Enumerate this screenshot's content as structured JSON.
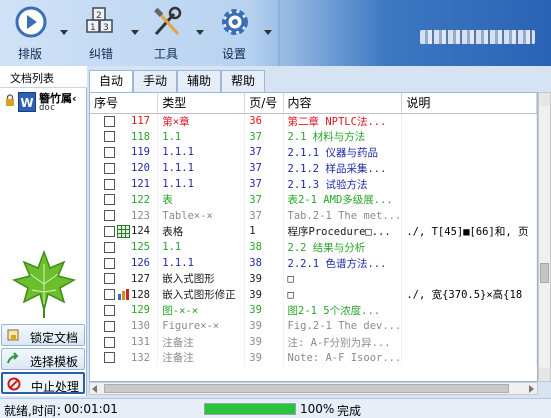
{
  "toolbar": {
    "buttons": [
      {
        "label": "排版",
        "icon": "play-icon"
      },
      {
        "label": "纠错",
        "icon": "abc-blocks-icon"
      },
      {
        "label": "工具",
        "icon": "tools-icon"
      },
      {
        "label": "设置",
        "icon": "gear-icon"
      }
    ]
  },
  "sidebar": {
    "title": "文档列表",
    "doc": {
      "name": "簪竹属‹",
      "ext": "doc",
      "icon": "word-doc-icon"
    },
    "buttons": [
      {
        "label": "锁定文档",
        "icon": "lock-doc-icon"
      },
      {
        "label": "选择模板",
        "icon": "arrow-icon"
      },
      {
        "label": "中止处理",
        "icon": "stop-icon"
      }
    ]
  },
  "tabs": [
    "自动",
    "手动",
    "辅助",
    "帮助"
  ],
  "table": {
    "columns": [
      "序号",
      "类型",
      "页/号",
      "内容",
      "说明"
    ],
    "rows": [
      {
        "num": "117",
        "type": "第×章",
        "page": "36",
        "content": "第二章  NPTLC法...",
        "desc": "",
        "color": "#e0141e"
      },
      {
        "num": "118",
        "type": "1.1",
        "page": "37",
        "content": "2.1 材料与方法",
        "desc": "",
        "color": "#2aa52a"
      },
      {
        "num": "119",
        "type": "1.1.1",
        "page": "37",
        "content": "2.1.1 仪器与药品",
        "desc": "",
        "color": "#1c2aa8"
      },
      {
        "num": "120",
        "type": "1.1.1",
        "page": "37",
        "content": "2.1.2 样品采集...",
        "desc": "",
        "color": "#1c2aa8"
      },
      {
        "num": "121",
        "type": "1.1.1",
        "page": "37",
        "content": "2.1.3 试验方法",
        "desc": "",
        "color": "#1c2aa8"
      },
      {
        "num": "122",
        "type": "表",
        "page": "37",
        "content": "表2-1 AMD多级展...",
        "desc": "",
        "color": "#2aa52a"
      },
      {
        "num": "123",
        "type": "Table×-×",
        "page": "37",
        "content": "Tab.2-1 The met...",
        "desc": "",
        "color": "#8a8a8a"
      },
      {
        "num": "124",
        "type": "表格",
        "page": "1",
        "content": "程序Procedure□...",
        "desc": "./, T[45]■[66]和, 页",
        "color": "#1a1a1a",
        "icon": "table-icon"
      },
      {
        "num": "125",
        "type": "1.1",
        "page": "38",
        "content": "2.2 结果与分析",
        "desc": "",
        "color": "#2aa52a"
      },
      {
        "num": "126",
        "type": "1.1.1",
        "page": "38",
        "content": "2.2.1 色谱方法...",
        "desc": "",
        "color": "#1c2aa8"
      },
      {
        "num": "127",
        "type": "嵌入式图形",
        "page": "39",
        "content": "□",
        "desc": "",
        "color": "#1a1a1a"
      },
      {
        "num": "128",
        "type": "嵌入式图形修正",
        "page": "39",
        "content": "□",
        "desc": "./, 宽{370.5}×高{18",
        "color": "#1a1a1a",
        "icon": "chart-icon"
      },
      {
        "num": "129",
        "type": "图-×-×",
        "page": "39",
        "content": "图2-1  5个浓度...",
        "desc": "",
        "color": "#2aa52a"
      },
      {
        "num": "130",
        "type": "Figure×-×",
        "page": "39",
        "content": "Fig.2-1 The dev...",
        "desc": "",
        "color": "#8a8a8a"
      },
      {
        "num": "131",
        "type": "注备注",
        "page": "39",
        "content": "注: A-F分别为异...",
        "desc": "",
        "color": "#8a8a8a"
      },
      {
        "num": "132",
        "type": "注备注",
        "page": "39",
        "content": "Note: A-F Isoor...",
        "desc": "",
        "color": "#8a8a8a"
      }
    ]
  },
  "status": {
    "state": "就绪,时间：",
    "time": "00:01:01",
    "progress": 1.0,
    "percent": "100%",
    "done": "完成"
  }
}
